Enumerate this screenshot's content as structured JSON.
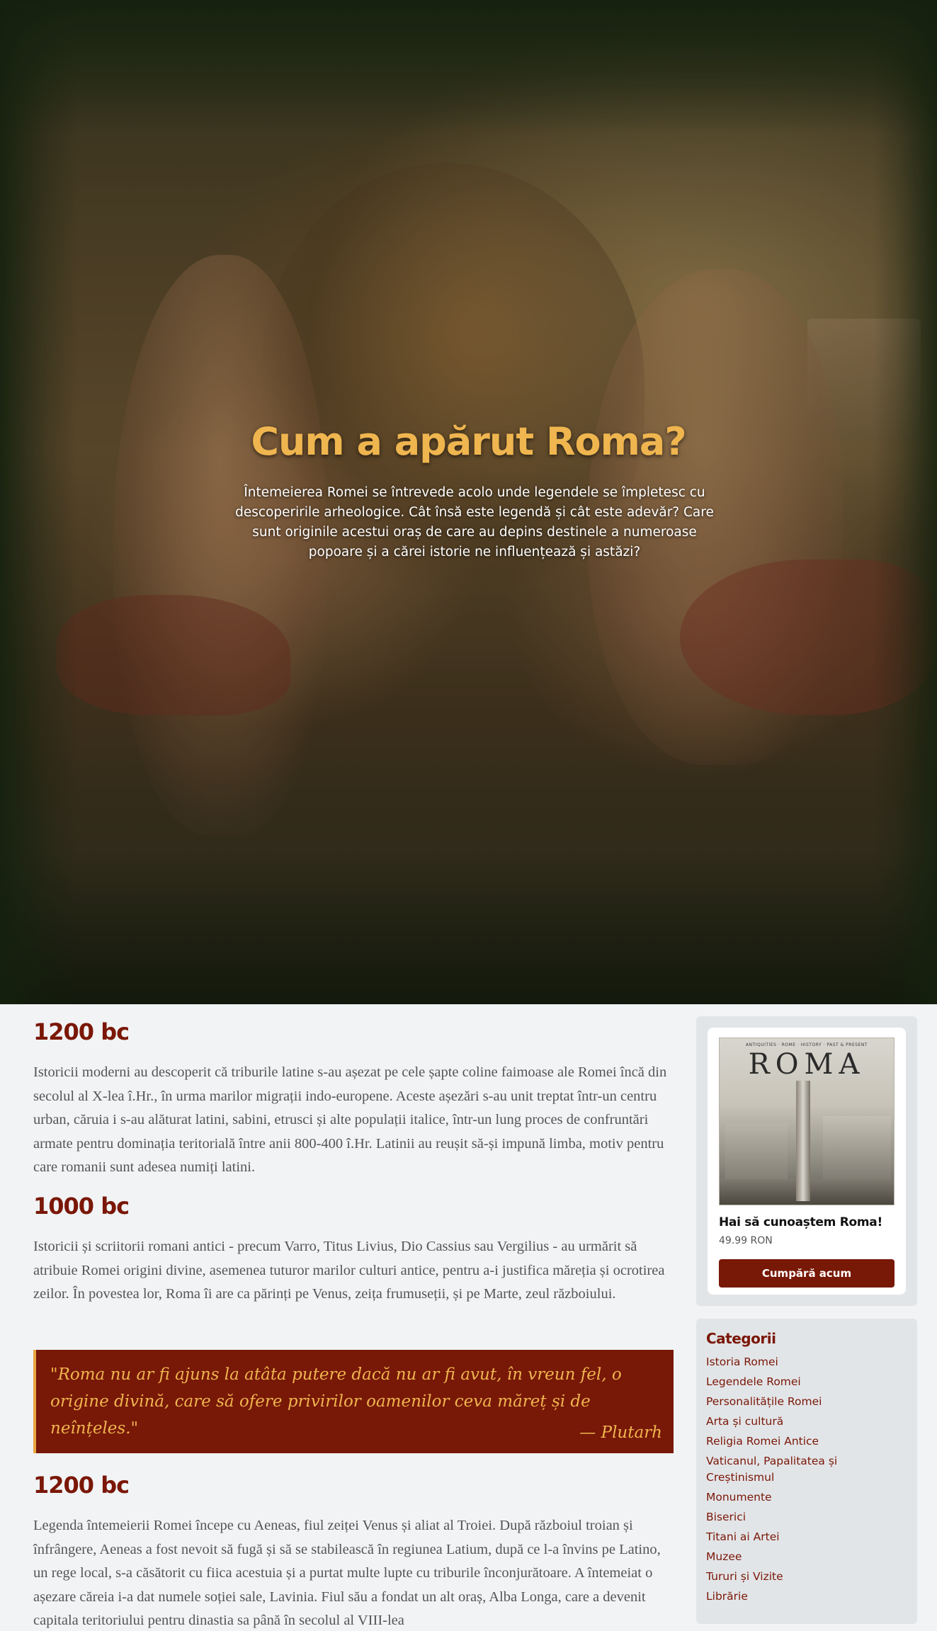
{
  "hero": {
    "title": "Cum a apărut Roma?",
    "lead": "Întemeierea Romei se întrevede acolo unde legendele se împletesc cu descoperirile arheologice. Cât însă este legendă și cât este adevăr? Care sunt originile acestui oraș de care au depins destinele a numeroase popoare și a cărei istorie ne influențează și astăzi?"
  },
  "main": {
    "sections": [
      {
        "heading": "1200 bc",
        "text": "Istoricii moderni au descoperit că triburile latine s-au așezat pe cele șapte coline faimoase ale Romei încă din secolul al X-lea î.Hr., în urma marilor migrații indo-europene. Aceste așezări s-au unit treptat într-un centru urban, căruia i s-au alăturat latini, sabini, etrusci și alte populații italice, într-un lung proces de confruntări armate pentru dominația teritorială între anii 800-400 î.Hr. Latinii au reușit să-și impună limba, motiv pentru care romanii sunt adesea numiți latini."
      },
      {
        "heading": "1000 bc",
        "text": "Istoricii și scriitorii romani antici - precum Varro, Titus Livius, Dio Cassius sau Vergilius - au urmărit să atribuie Romei origini divine, asemenea tuturor marilor culturi antice, pentru a-i justifica măreția și ocrotirea zeilor. În povestea lor, Roma îi are ca părinți pe Venus, zeița frumuseții, și pe Marte, zeul războiului."
      },
      {
        "heading": "1200 bc",
        "text": "Legenda întemeierii Romei începe cu Aeneas, fiul zeiței Venus și aliat al Troiei. După războiul troian și înfrângere, Aeneas a fost nevoit să fugă și să se stabilească în regiunea Latium, după ce l-a învins pe Latino, un rege local, s-a căsătorit cu fiica acestuia și a purtat multe lupte cu triburile înconjurătoare. A întemeiat o așezare căreia i-a dat numele soției sale, Lavinia. Fiul său a fondat un alt oraș, Alba Longa, care a devenit capitala teritoriului pentru dinastia sa până în secolul al VIII-lea"
      }
    ],
    "quote": {
      "text": "\"Roma nu ar fi ajuns la atâta putere dacă nu ar fi avut, în vreun fel, o origine divină, care să ofere privirilor oamenilor ceva măreț și de neînțeles.\"",
      "author": "— Plutarh"
    }
  },
  "sidebar": {
    "book": {
      "cover_subtitle": "ANTIQUITIES · ROME · HISTORY · PAST & PRESENT",
      "cover_title": "ROMA",
      "title": "Hai să cunoaștem Roma!",
      "price": "49.99 RON",
      "buy_label": "Cumpără acum"
    },
    "categories": {
      "title": "Categorii",
      "items": [
        "Istoria Romei",
        "Legendele Romei",
        "Personalitățile Romei",
        "Arta și cultură",
        "Religia Romei Antice",
        "Vaticanul, Papalitatea și Creștinismul",
        "Monumente",
        "Biserici",
        "Titani ai Artei",
        "Muzee",
        "Tururi și Vizite",
        "Librărie"
      ]
    }
  },
  "colors": {
    "accent_dark_red": "#781807",
    "heading_red": "#7a1707",
    "gold": "#efb54f",
    "page_bg": "#f1f3f5",
    "panel_bg": "#e2e5e8"
  }
}
